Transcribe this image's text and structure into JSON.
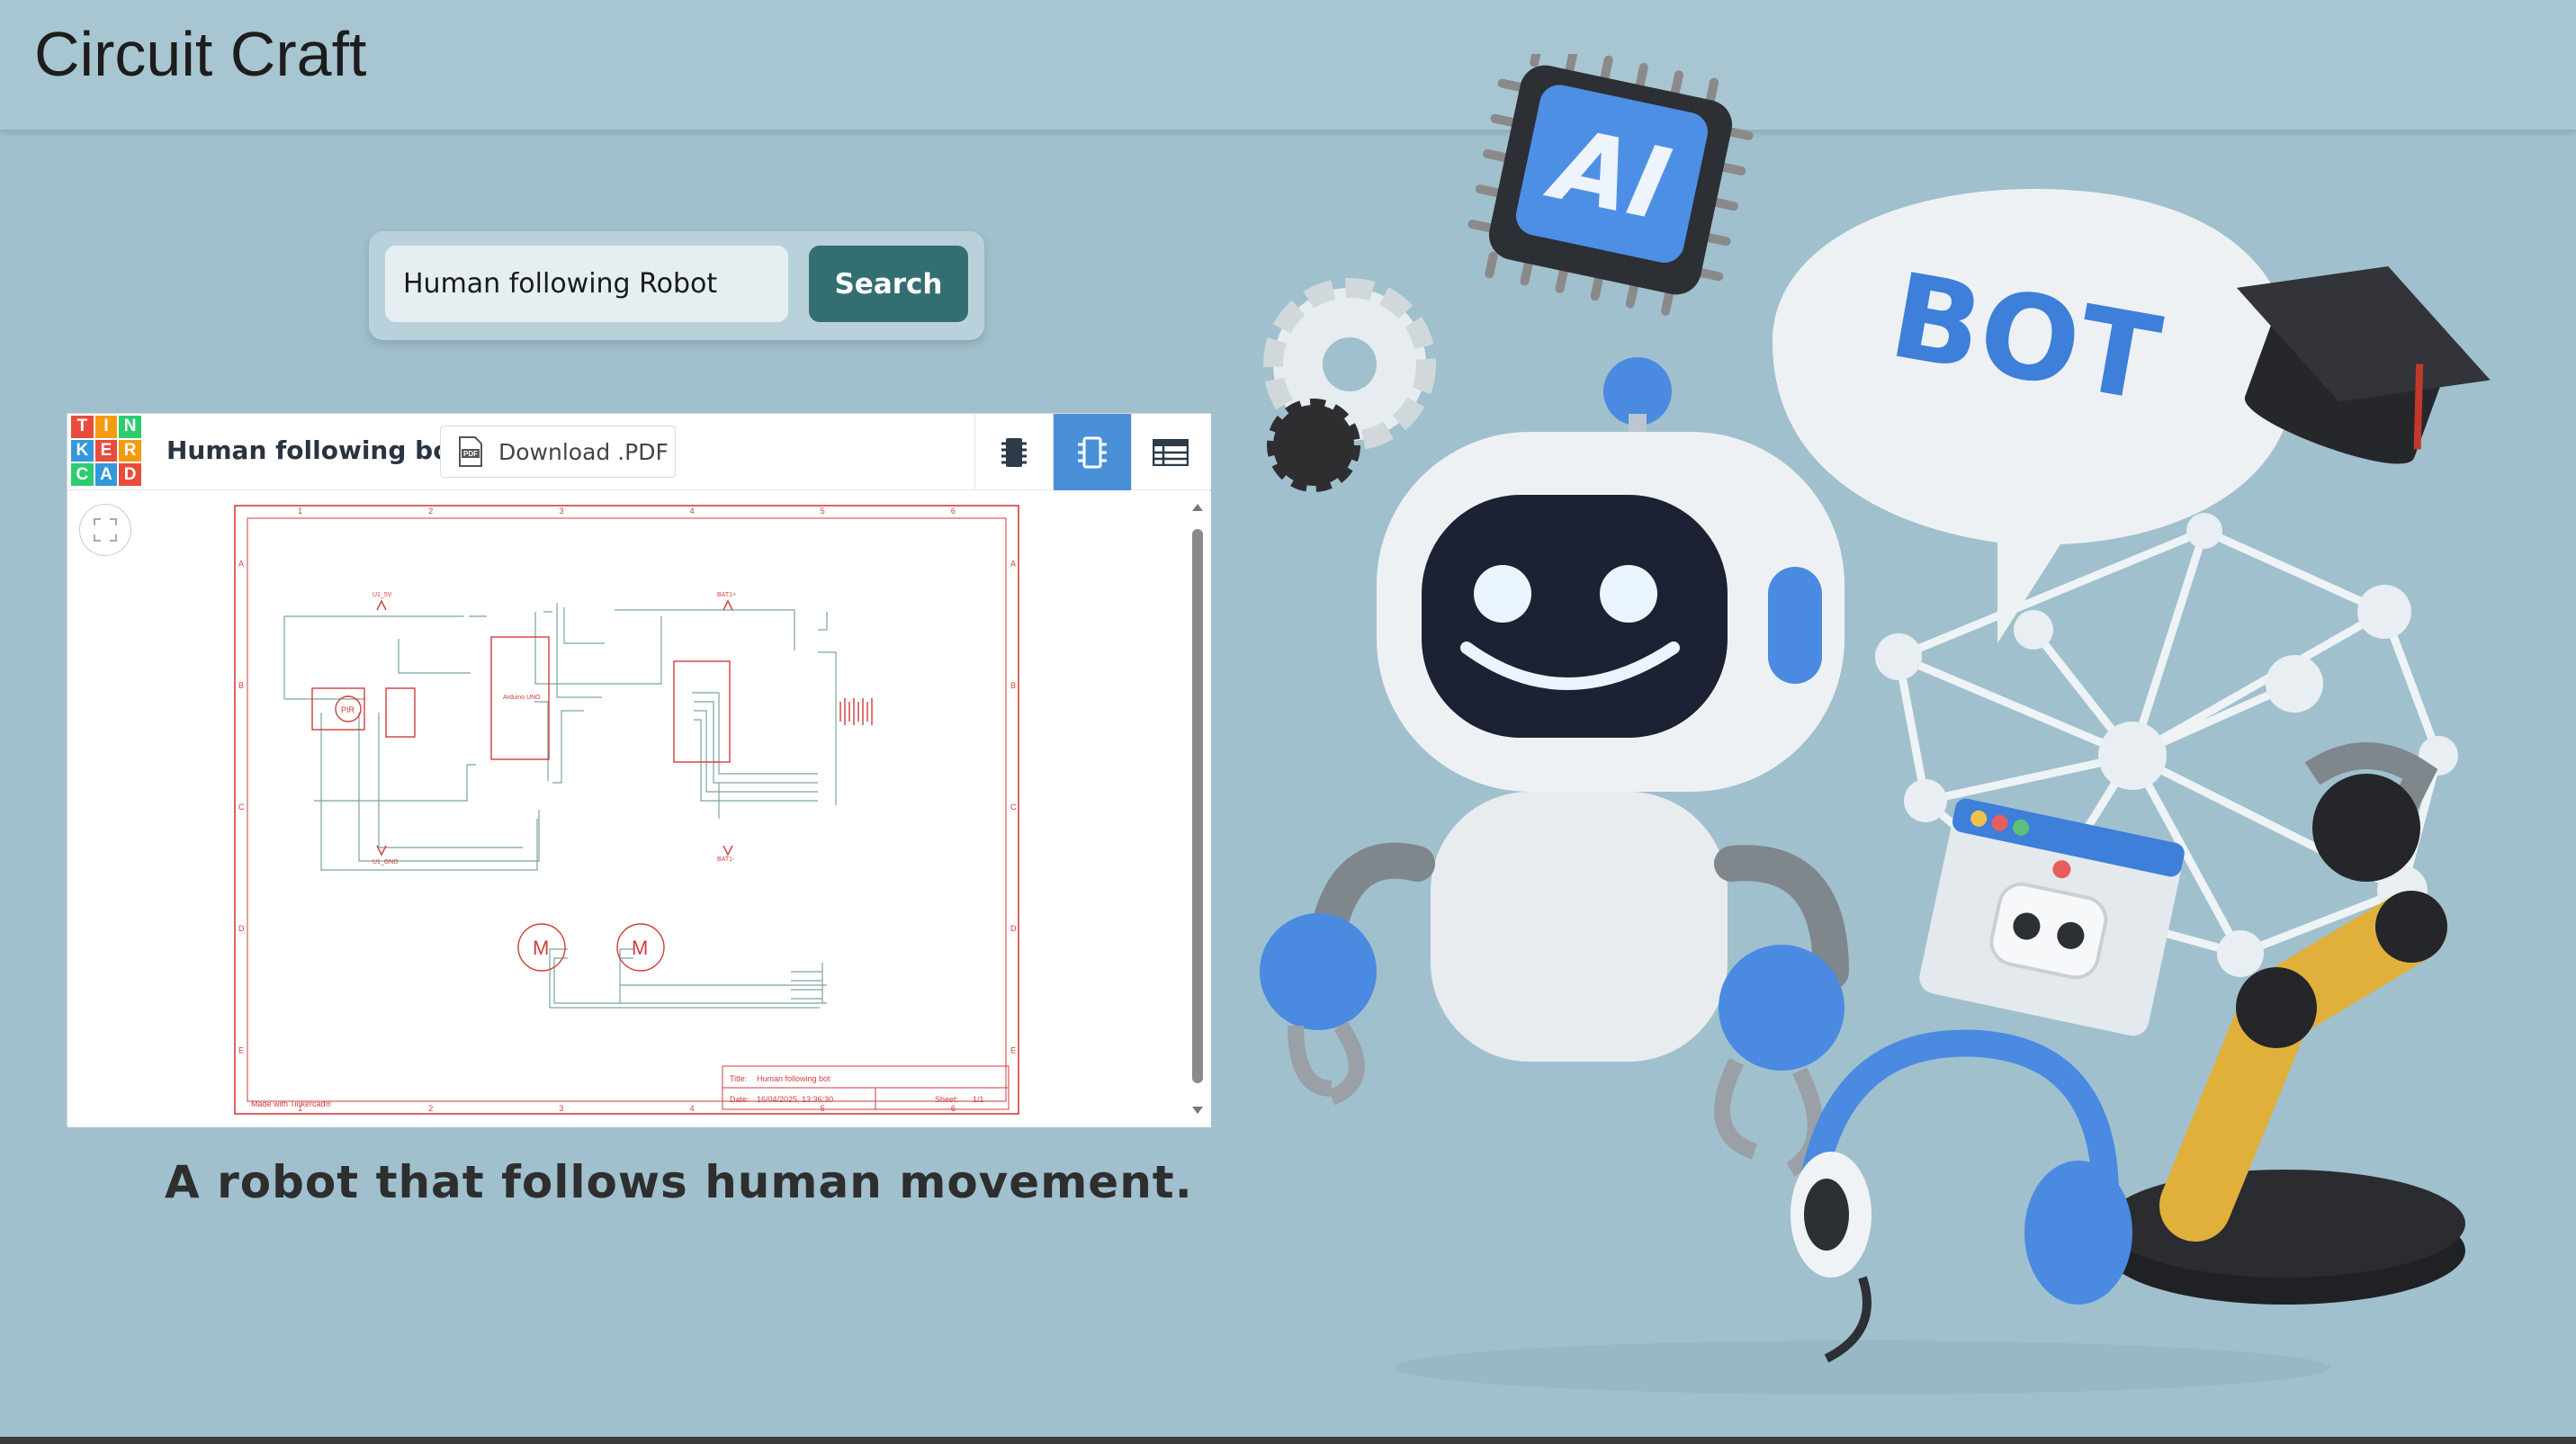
{
  "app": {
    "title": "Circuit Craft"
  },
  "search": {
    "value": "Human following Robot",
    "button_label": "Search"
  },
  "viewer": {
    "logo_letters": [
      "T",
      "I",
      "N",
      "K",
      "E",
      "R",
      "C",
      "A",
      "D"
    ],
    "logo_colors": [
      "#e84c3d",
      "#f39c12",
      "#2ecc71",
      "#3498db",
      "#e84c3d",
      "#f39c12",
      "#2ecc71",
      "#3498db",
      "#e84c3d"
    ],
    "title": "Human following bot",
    "download_label": "Download .PDF",
    "download_icon": "pdf-icon",
    "tabs": [
      "circuit-view-icon",
      "schematic-view-icon",
      "component-list-icon"
    ],
    "active_tab": "schematic-view-icon",
    "schematic": {
      "col_labels": [
        "1",
        "2",
        "3",
        "4",
        "5",
        "6"
      ],
      "row_labels": [
        "A",
        "B",
        "C",
        "D",
        "E"
      ],
      "made_with": "Made with Tinkercad®",
      "title_label": "Title:",
      "title_value": "Human following bot",
      "date_label": "Date:",
      "date_value": "16/04/2025, 13:36:30",
      "sheet_label": "Sheet:",
      "sheet_value": "1/1",
      "pir_label": "PIR",
      "motor_label": "M",
      "arduino_label": "Arduino UNO",
      "u1_5v": "U1_5V",
      "u1_gnd": "U1_GND",
      "bat_plus": "BAT1+",
      "bat_minus": "BAT1-"
    }
  },
  "caption": "A robot that follows human movement.",
  "hero": {
    "chip_text": "AI",
    "bubble_text": "BOT",
    "accent": "#3d7fd9",
    "icons": [
      "ai-chip-icon",
      "gear-icon",
      "robot-mascot-icon",
      "speech-bubble-icon",
      "graduation-cap-icon",
      "network-mesh-icon",
      "robot-window-icon",
      "robotic-arm-icon",
      "headset-icon"
    ]
  }
}
